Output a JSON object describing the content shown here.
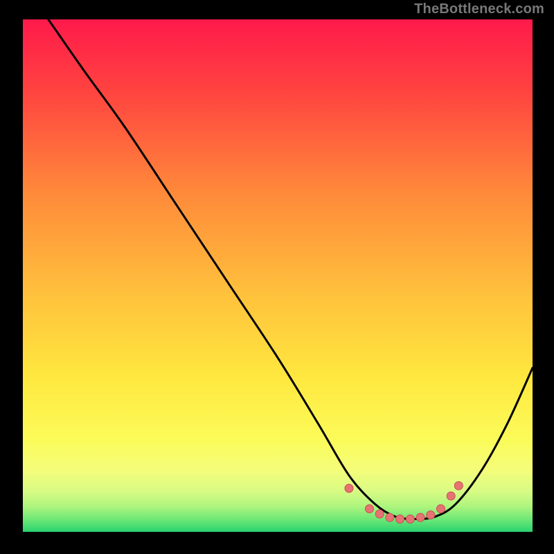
{
  "attribution": "TheBottleneck.com",
  "colors": {
    "page_bg": "#000000",
    "attribution_text": "#787878",
    "curve_stroke": "#000000",
    "dot_fill": "#e57373",
    "dot_stroke": "#c94f4f"
  },
  "chart_data": {
    "type": "line",
    "title": "",
    "xlabel": "",
    "ylabel": "",
    "xlim": [
      0,
      1
    ],
    "ylim": [
      0,
      1
    ],
    "note": "No axes or labels rendered; curve is a bottleneck V-shape over a vertical red→yellow→green gradient. x/y are normalized 0..1 within the plot rectangle (y=0 is bottom).",
    "series": [
      {
        "name": "bottleneck-curve",
        "x": [
          0.05,
          0.12,
          0.2,
          0.3,
          0.4,
          0.5,
          0.58,
          0.64,
          0.69,
          0.73,
          0.77,
          0.81,
          0.85,
          0.9,
          0.95,
          1.0
        ],
        "y": [
          1.0,
          0.9,
          0.79,
          0.64,
          0.49,
          0.34,
          0.21,
          0.11,
          0.055,
          0.03,
          0.025,
          0.03,
          0.055,
          0.12,
          0.21,
          0.32
        ]
      }
    ],
    "marked_points": {
      "name": "optimal-region-dots",
      "x": [
        0.64,
        0.68,
        0.7,
        0.72,
        0.74,
        0.76,
        0.78,
        0.8,
        0.82,
        0.84,
        0.855
      ],
      "y": [
        0.085,
        0.045,
        0.035,
        0.028,
        0.025,
        0.025,
        0.028,
        0.033,
        0.045,
        0.07,
        0.09
      ]
    },
    "gradient": {
      "direction": "vertical",
      "stops": [
        {
          "offset": 0.0,
          "color": "#ff1a4b"
        },
        {
          "offset": 0.14,
          "color": "#ff4340"
        },
        {
          "offset": 0.34,
          "color": "#ff8a3a"
        },
        {
          "offset": 0.54,
          "color": "#ffc23c"
        },
        {
          "offset": 0.7,
          "color": "#ffe83f"
        },
        {
          "offset": 0.82,
          "color": "#fbfb59"
        },
        {
          "offset": 0.88,
          "color": "#f4fd7a"
        },
        {
          "offset": 0.92,
          "color": "#d9fb84"
        },
        {
          "offset": 0.95,
          "color": "#aef57e"
        },
        {
          "offset": 0.975,
          "color": "#6fe877"
        },
        {
          "offset": 1.0,
          "color": "#2bd36f"
        }
      ]
    }
  }
}
